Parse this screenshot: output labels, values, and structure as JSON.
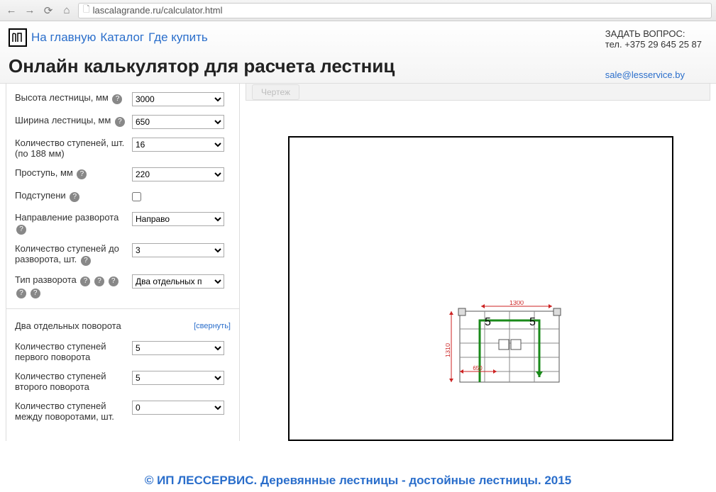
{
  "browser": {
    "url": "lascalagrande.ru/calculator.html"
  },
  "nav": {
    "home": "На главную",
    "catalog": "Каталог",
    "where": "Где купить"
  },
  "contact": {
    "ask": "ЗАДАТЬ ВОПРОС:",
    "tel": "тел. +375 29 645 25 87",
    "email": "sale@lesservice.by"
  },
  "title": "Онлайн калькулятор для расчета лестниц",
  "tab": {
    "drawing": "Чертеж"
  },
  "form": {
    "height_label": "Высота лестницы, мм",
    "height_value": "3000",
    "width_label": "Ширина лестницы, мм",
    "width_value": "650",
    "steps_label": "Количество ступеней, шт. (по 188 мм)",
    "steps_value": "16",
    "tread_label": "Проступь, мм",
    "tread_value": "220",
    "risers_label": "Подступени",
    "direction_label": "Направление разворота",
    "direction_value": "Направо",
    "steps_before_label": "Количество ступеней до разворота, шт.",
    "steps_before_value": "3",
    "turn_type_label": "Тип разворота",
    "turn_type_value": "Два отдельных п"
  },
  "section": {
    "title": "Два отдельных поворота",
    "collapse": "[свернуть]",
    "first_turn_label": "Количество ступеней первого поворота",
    "first_turn_value": "5",
    "second_turn_label": "Количество ступеней второго поворота",
    "second_turn_value": "5",
    "between_label": "Количество ступеней между поворотами, шт.",
    "between_value": "0"
  },
  "diagram": {
    "dim_width": "1300",
    "dim_height": "1310",
    "dim_bottom": "650",
    "label_left": "5",
    "label_right": "5"
  },
  "footer": "© ИП ЛЕССЕРВИС. Деревянные лестницы - достойные лестницы. 2015"
}
